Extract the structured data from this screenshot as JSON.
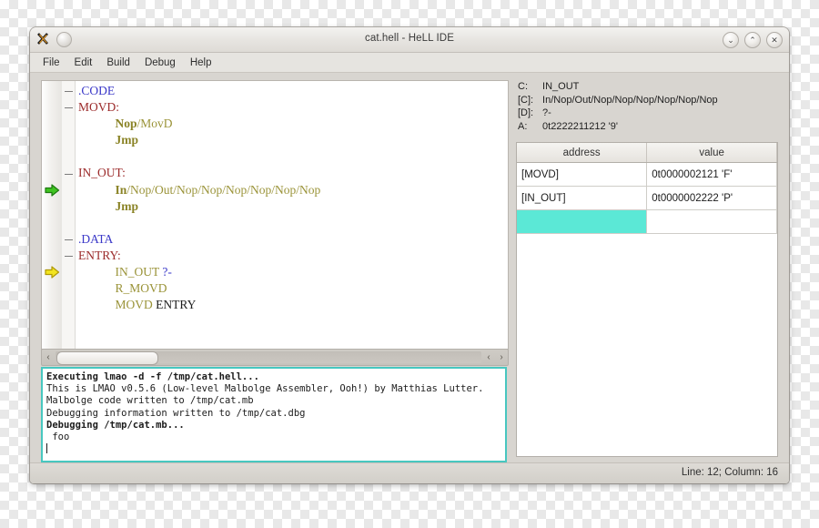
{
  "window": {
    "title": "cat.hell - HeLL IDE",
    "app_icon": "x-app-icon",
    "menu_dot_icon": "circle-button-icon",
    "buttons": {
      "minimize": "⌄",
      "maximize": "⌃",
      "close": "✕"
    }
  },
  "menubar": {
    "items": [
      {
        "label": "File"
      },
      {
        "label": "Edit"
      },
      {
        "label": "Build"
      },
      {
        "label": "Debug"
      },
      {
        "label": "Help"
      }
    ]
  },
  "editor": {
    "lines": [
      {
        "fold": true,
        "marker": "",
        "tokens": [
          {
            "t": ".CODE",
            "c": "tok-dir"
          }
        ]
      },
      {
        "fold": true,
        "marker": "",
        "tokens": [
          {
            "t": "MOVD:",
            "c": "tok-label"
          }
        ]
      },
      {
        "fold": false,
        "marker": "",
        "tokens": [
          {
            "t": "            ",
            "c": "tok-plain"
          },
          {
            "t": "Nop",
            "c": "tok-op-b"
          },
          {
            "t": "/MovD",
            "c": "tok-op"
          }
        ]
      },
      {
        "fold": false,
        "marker": "",
        "tokens": [
          {
            "t": "            ",
            "c": "tok-plain"
          },
          {
            "t": "Jmp",
            "c": "tok-op-b"
          }
        ]
      },
      {
        "fold": false,
        "marker": "",
        "tokens": [
          {
            "t": "",
            "c": "tok-plain"
          }
        ]
      },
      {
        "fold": true,
        "marker": "",
        "tokens": [
          {
            "t": "IN_OUT:",
            "c": "tok-label"
          }
        ]
      },
      {
        "fold": false,
        "marker": "green-arrow-marker",
        "tokens": [
          {
            "t": "            ",
            "c": "tok-plain"
          },
          {
            "t": "In",
            "c": "tok-op-b"
          },
          {
            "t": "/Nop/Out/Nop/Nop/Nop/Nop/Nop/Nop",
            "c": "tok-op"
          }
        ]
      },
      {
        "fold": false,
        "marker": "",
        "tokens": [
          {
            "t": "            ",
            "c": "tok-plain"
          },
          {
            "t": "Jmp",
            "c": "tok-op-b"
          }
        ]
      },
      {
        "fold": false,
        "marker": "",
        "tokens": [
          {
            "t": "",
            "c": "tok-plain"
          }
        ]
      },
      {
        "fold": true,
        "marker": "",
        "tokens": [
          {
            "t": ".DATA",
            "c": "tok-dir"
          }
        ]
      },
      {
        "fold": true,
        "marker": "",
        "tokens": [
          {
            "t": "ENTRY:",
            "c": "tok-label"
          }
        ]
      },
      {
        "fold": false,
        "marker": "yellow-arrow-marker",
        "tokens": [
          {
            "t": "            ",
            "c": "tok-plain"
          },
          {
            "t": "IN_OUT ",
            "c": "tok-op"
          },
          {
            "t": "?-",
            "c": "tok-q"
          }
        ]
      },
      {
        "fold": false,
        "marker": "",
        "tokens": [
          {
            "t": "            ",
            "c": "tok-plain"
          },
          {
            "t": "R_MOVD",
            "c": "tok-op"
          }
        ]
      },
      {
        "fold": false,
        "marker": "",
        "tokens": [
          {
            "t": "            ",
            "c": "tok-plain"
          },
          {
            "t": "MOVD ",
            "c": "tok-op"
          },
          {
            "t": "ENTRY",
            "c": "tok-plain"
          }
        ]
      }
    ],
    "scrollbar": {
      "left_arrow": "‹",
      "right_arrow": "›"
    }
  },
  "console": {
    "lines": [
      {
        "text": "Executing lmao -d -f /tmp/cat.hell...",
        "bold": true
      },
      {
        "text": "This is LMAO v0.5.6 (Low-level Malbolge Assembler, Ooh!) by Matthias Lutter.",
        "bold": false
      },
      {
        "text": "Malbolge code written to /tmp/cat.mb",
        "bold": false
      },
      {
        "text": "Debugging information written to /tmp/cat.dbg",
        "bold": false
      },
      {
        "text": "Debugging /tmp/cat.mb...",
        "bold": true
      },
      {
        "text": " foo",
        "bold": false
      }
    ]
  },
  "registers": [
    {
      "key": "C:",
      "value": "IN_OUT"
    },
    {
      "key": "[C]:",
      "value": "In/Nop/Out/Nop/Nop/Nop/Nop/Nop/Nop"
    },
    {
      "key": "[D]:",
      "value": "?-"
    },
    {
      "key": "A:",
      "value": "0t2222211212 '9'"
    }
  ],
  "memory_table": {
    "columns": [
      "address",
      "value"
    ],
    "rows": [
      {
        "address": "[MOVD]",
        "value": "0t0000002121 'F'",
        "selected": false
      },
      {
        "address": "[IN_OUT]",
        "value": "0t0000002222 'P'",
        "selected": false
      },
      {
        "address": "",
        "value": "",
        "selected": true
      }
    ],
    "selection_color": "#5be8d6"
  },
  "statusbar": {
    "position": "Line: 12; Column: 16"
  }
}
